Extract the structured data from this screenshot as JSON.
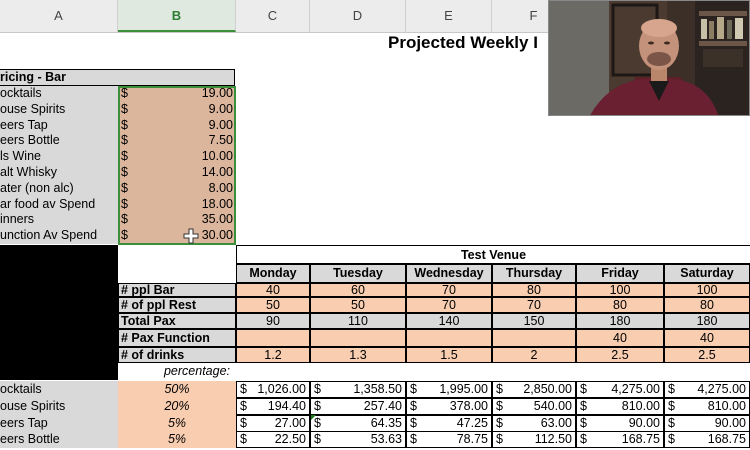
{
  "columns": [
    "A",
    "B",
    "C",
    "D",
    "E",
    "F"
  ],
  "sheet_title": "Projected Weekly I",
  "pricing": {
    "header": "ricing - Bar",
    "rows": [
      {
        "label": "ocktails",
        "currency": "$",
        "value": "19.00"
      },
      {
        "label": "ouse  Spirits",
        "currency": "$",
        "value": "9.00"
      },
      {
        "label": "eers Tap",
        "currency": "$",
        "value": "9.00"
      },
      {
        "label": "eers Bottle",
        "currency": "$",
        "value": "7.50"
      },
      {
        "label": "ls Wine",
        "currency": "$",
        "value": "10.00"
      },
      {
        "label": "alt Whisky",
        "currency": "$",
        "value": "14.00"
      },
      {
        "label": "ater (non alc)",
        "currency": "$",
        "value": "8.00"
      },
      {
        "label": "ar food av Spend",
        "currency": "$",
        "value": "18.00"
      },
      {
        "label": "inners",
        "currency": "$",
        "value": "35.00"
      },
      {
        "label": "unction Av Spend",
        "currency": "$",
        "value": "30.00"
      }
    ]
  },
  "venue": {
    "title": "Test Venue",
    "days": [
      "Monday",
      "Tuesday",
      "Wednesday",
      "Thursday",
      "Friday",
      "Saturday"
    ],
    "rows": [
      {
        "label": "# ppl Bar",
        "values": [
          "40",
          "60",
          "70",
          "80",
          "100",
          "100"
        ]
      },
      {
        "label": "# of ppl Rest",
        "values": [
          "50",
          "50",
          "70",
          "70",
          "80",
          "80"
        ]
      },
      {
        "label": "Total Pax",
        "values": [
          "90",
          "110",
          "140",
          "150",
          "180",
          "180"
        ]
      },
      {
        "label": "# Pax Function",
        "values": [
          "",
          "",
          "",
          "",
          "40",
          "40"
        ]
      },
      {
        "label": "# of drinks",
        "values": [
          "1.2",
          "1.3",
          "1.5",
          "2",
          "2.5",
          "2.5"
        ]
      }
    ],
    "percentage_label": "percentage:"
  },
  "sales": [
    {
      "label": "ocktails",
      "pct": "50%",
      "values": [
        "1,026.00",
        "1,358.50",
        "1,995.00",
        "2,850.00",
        "4,275.00",
        "4,275.00"
      ]
    },
    {
      "label": "ouse  Spirits",
      "pct": "20%",
      "values": [
        "194.40",
        "257.40",
        "378.00",
        "540.00",
        "810.00",
        "810.00"
      ]
    },
    {
      "label": "eers Tap",
      "pct": "5%",
      "values": [
        "27.00",
        "64.35",
        "47.25",
        "63.00",
        "90.00",
        "90.00"
      ]
    },
    {
      "label": "eers Bottle",
      "pct": "5%",
      "values": [
        "22.50",
        "53.63",
        "78.75",
        "112.50",
        "168.75",
        "168.75"
      ]
    }
  ],
  "currency_symbol": "$"
}
